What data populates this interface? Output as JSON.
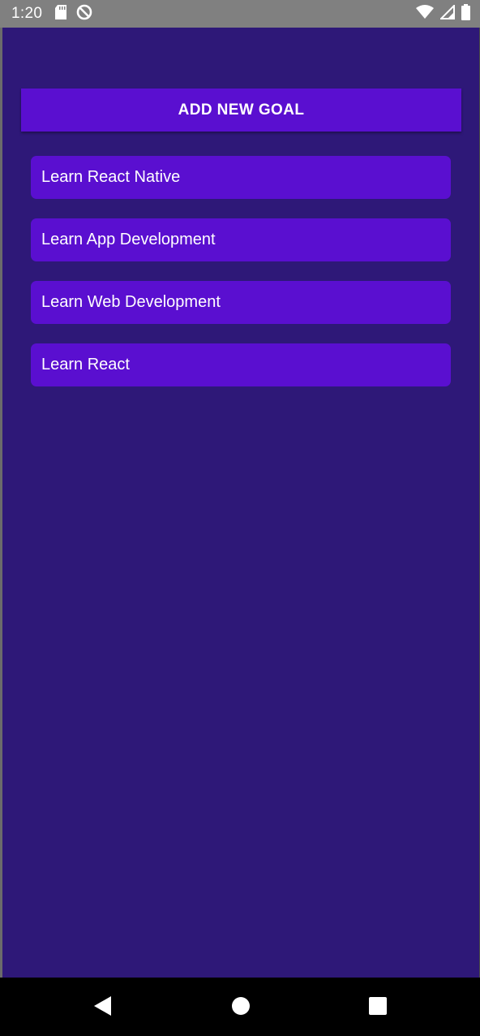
{
  "status_bar": {
    "time": "1:20",
    "left_icons": [
      "sd-card-icon",
      "sync-disabled-icon"
    ],
    "right_icons": [
      "wifi-icon",
      "signal-icon",
      "battery-icon"
    ]
  },
  "main": {
    "add_goal_label": "ADD NEW GOAL",
    "goals": [
      {
        "label": "Learn React Native"
      },
      {
        "label": "Learn App Development"
      },
      {
        "label": "Learn Web Development"
      },
      {
        "label": "Learn React"
      }
    ]
  },
  "nav_bar": {
    "buttons": [
      "back-icon",
      "home-icon",
      "recents-icon"
    ]
  },
  "colors": {
    "background": "#2e1878",
    "accent": "#5a0fd0",
    "status_bar": "#808080",
    "text": "#ffffff"
  }
}
